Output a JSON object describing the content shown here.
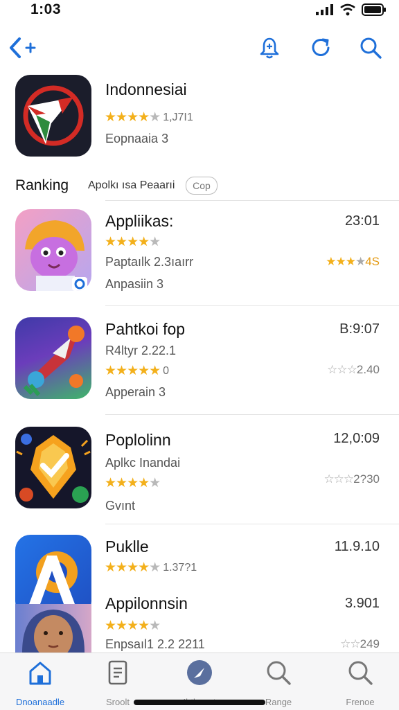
{
  "status_bar": {
    "time": "1:03"
  },
  "featured": {
    "title": "Indonnesiai",
    "rating": 4,
    "rating_count": "1,J7I1",
    "subtitle": "Eopnaaia 3"
  },
  "ranking": {
    "label": "Ranking",
    "sublabel": "Apolkı ısa Peaarıi",
    "chip": "Cop"
  },
  "apps": [
    {
      "title": "Appliikas:",
      "line2": "",
      "rating": 4,
      "rating_text": "",
      "line3": "Paptaılk 2.3ıaırr",
      "line4": "Anpasiin 3",
      "right_time": "23:01",
      "right_rating": 3,
      "right_value": "4S"
    },
    {
      "title": "Pahtkoi fop",
      "line2": "R4ltyr 2.22.1",
      "rating": 5,
      "rating_text": "0",
      "line3": "",
      "line4": "Apperain 3",
      "right_time": "B:9:07",
      "right_rating": 0,
      "right_value": "2.40"
    },
    {
      "title": "Poplolinn",
      "line2": "Aplkc Inandai",
      "rating": 4,
      "rating_text": "",
      "line3": "",
      "line4": "Gvınt",
      "right_time": "12,0:09",
      "right_rating": 0,
      "right_value": "2?30"
    },
    {
      "title": "Puklle",
      "line2": "",
      "rating": 4,
      "rating_text": "1.37?1",
      "line3": "",
      "line4": "",
      "right_time": "11.9.10",
      "right_rating": 0,
      "right_value": ""
    },
    {
      "title": "Appilonnsin",
      "line2": "",
      "rating": 4,
      "rating_text": "",
      "line3": "Enpsaıl1 2.2 2211",
      "line4": "",
      "right_time": "3.901",
      "right_rating": 0,
      "right_value": "249"
    }
  ],
  "tabs": [
    {
      "label": "Dnoanaadle",
      "icon": "house-icon",
      "active": true
    },
    {
      "label": "Sroolt",
      "icon": "document-icon",
      "active": false
    },
    {
      "label": "Ibtlnonrt",
      "icon": "compass-icon",
      "active": false
    },
    {
      "label": "Range",
      "icon": "search-icon",
      "active": false
    },
    {
      "label": "Frenoe",
      "icon": "search-icon",
      "active": false
    }
  ],
  "colors": {
    "accent": "#1e6fd9",
    "star": "#f3b01b",
    "star_empty": "#b9b9b9"
  }
}
